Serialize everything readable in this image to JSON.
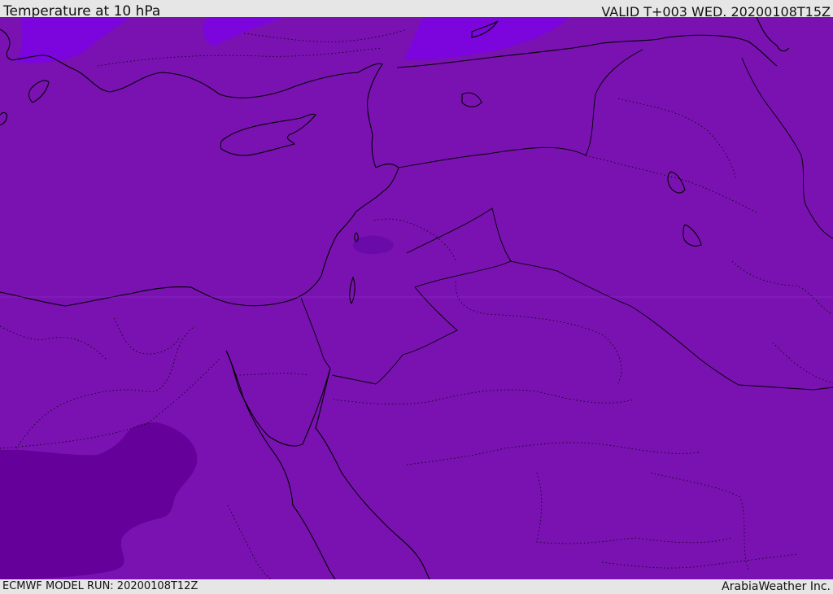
{
  "header": {
    "title": "Temperature at 10 hPa",
    "valid": "VALID T+003 WED. 20200108T15Z"
  },
  "footer": {
    "model_run": "ECMWF MODEL RUN: 20200108T12Z",
    "credit": "ArabiaWeather Inc."
  },
  "map": {
    "background_color": "#7a12b2",
    "warm_patch_color": "#7b05dc",
    "cold_patch_color": "#65009a",
    "coastline_color": "#000000",
    "border_style": "dotted"
  }
}
